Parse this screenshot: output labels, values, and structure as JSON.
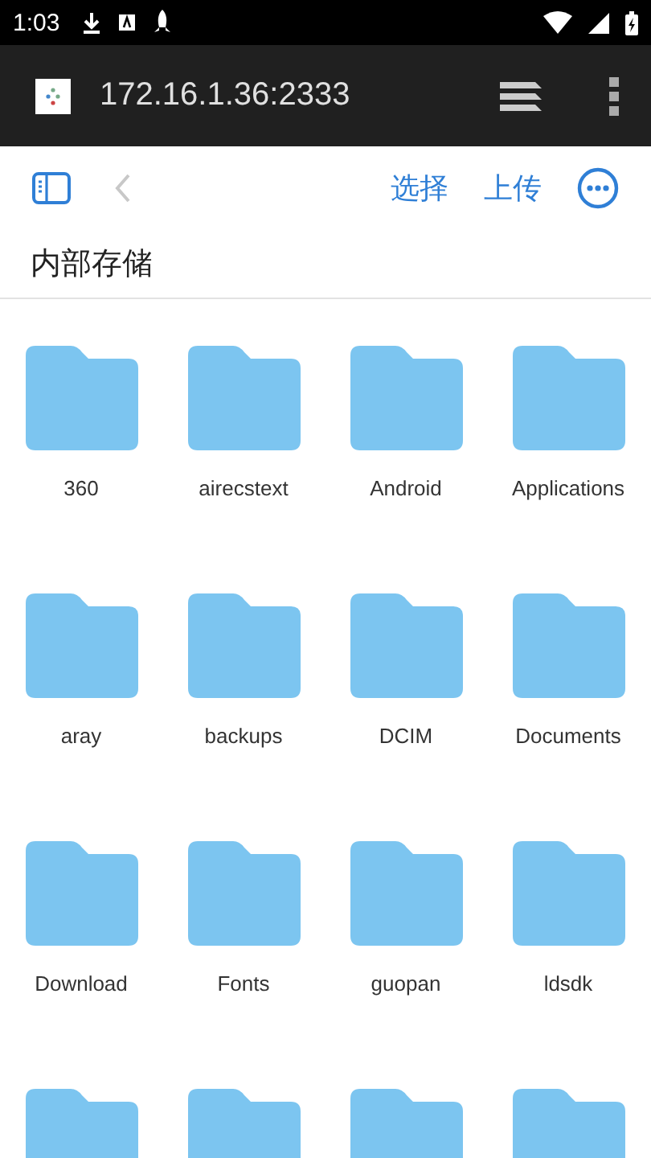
{
  "status_bar": {
    "time": "1:03"
  },
  "browser": {
    "address": "172.16.1.36:2333"
  },
  "toolbar": {
    "actions": [
      "选择",
      "上传"
    ],
    "back_disabled": true
  },
  "breadcrumb": "内部存储",
  "items": [
    {
      "kind": "folder",
      "name": "360"
    },
    {
      "kind": "folder",
      "name": "airecstext"
    },
    {
      "kind": "folder",
      "name": "Android"
    },
    {
      "kind": "folder",
      "name": "Applications"
    },
    {
      "kind": "folder",
      "name": "aray"
    },
    {
      "kind": "folder",
      "name": "backups"
    },
    {
      "kind": "folder",
      "name": "DCIM"
    },
    {
      "kind": "folder",
      "name": "Documents"
    },
    {
      "kind": "folder",
      "name": "Download"
    },
    {
      "kind": "folder",
      "name": "Fonts"
    },
    {
      "kind": "folder",
      "name": "guopan"
    },
    {
      "kind": "folder",
      "name": "ldsdk"
    },
    {
      "kind": "folder"
    },
    {
      "kind": "folder"
    },
    {
      "kind": "folder"
    },
    {
      "kind": "folder"
    }
  ]
}
